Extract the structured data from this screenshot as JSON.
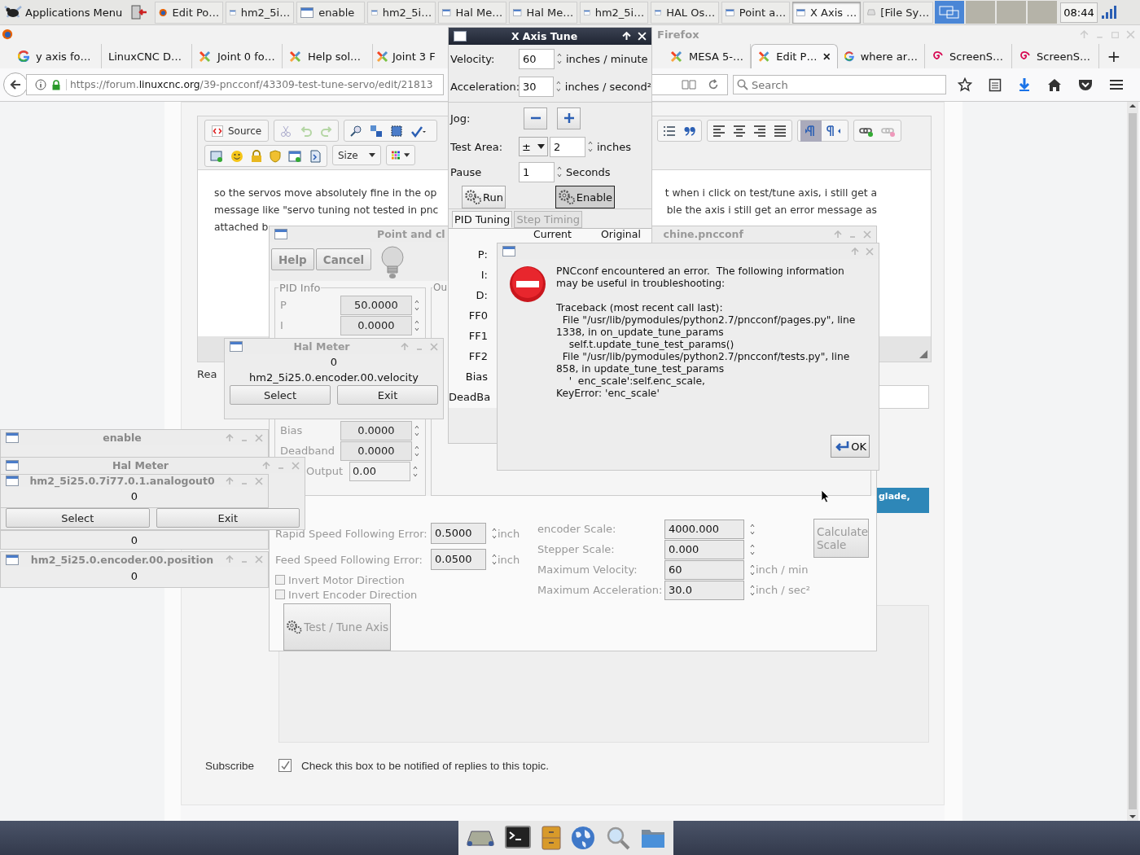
{
  "top_panel": {
    "apps_menu": "Applications Menu",
    "tasks": [
      {
        "label": "Edit Po…",
        "kind": "firefox",
        "selected": false
      },
      {
        "label": "hm2_5i…",
        "kind": "window",
        "selected": false
      },
      {
        "label": "enable",
        "kind": "window",
        "selected": false
      },
      {
        "label": "hm2_5i…",
        "kind": "window",
        "selected": false
      },
      {
        "label": "Hal Me…",
        "kind": "window",
        "selected": false
      },
      {
        "label": "Hal Me…",
        "kind": "window",
        "selected": false
      },
      {
        "label": "hm2_5i…",
        "kind": "window",
        "selected": false
      },
      {
        "label": "HAL Os…",
        "kind": "window",
        "selected": false
      },
      {
        "label": "Point a…",
        "kind": "window",
        "selected": false
      },
      {
        "label": "X Axis …",
        "kind": "window",
        "selected": true
      },
      {
        "label": "[File Sy…",
        "kind": "drive",
        "selected": false
      }
    ],
    "workspaces": [
      {
        "selected": true
      },
      {
        "selected": false
      },
      {
        "selected": false
      },
      {
        "selected": false
      }
    ],
    "clock": "08:44"
  },
  "firefox": {
    "title": "Firefox",
    "tabs": [
      {
        "label": "y axis fo…",
        "kind": "google",
        "selected": false
      },
      {
        "label": "LinuxCNC D…",
        "kind": "plain",
        "selected": false
      },
      {
        "label": "Joint 0 fo…",
        "kind": "joomla",
        "selected": false
      },
      {
        "label": "Help sol…",
        "kind": "joomla",
        "selected": false
      },
      {
        "label": "Joint 3 F",
        "kind": "joomla",
        "selected": false
      },
      {
        "label": "MESA 5-…",
        "kind": "joomla",
        "selected": false
      },
      {
        "label": "Edit P…",
        "kind": "joomla",
        "selected": true
      },
      {
        "label": "where ar…",
        "kind": "google",
        "selected": false
      },
      {
        "label": "ScreenS…",
        "kind": "debian",
        "selected": false
      },
      {
        "label": "ScreenS…",
        "kind": "debian",
        "selected": false
      }
    ],
    "new_tab": "+",
    "url": {
      "prefix": "https://forum.",
      "domain": "linuxcnc.org",
      "path": "/39-pncconf/43309-test-tune-servo/edit/21813"
    },
    "search_placeholder": "Search"
  },
  "editor": {
    "source_button": "Source",
    "size_menu": "Size",
    "lines": [
      {
        "left": "so the servos move absolutely fine in the op",
        "right": "t when i click on test/tune axis, i still get a"
      },
      {
        "left": "message like \"servo tuning not tested in pnc",
        "right": "ble the axis i still get an error message as"
      },
      {
        "left": "attached b"
      }
    ]
  },
  "page": {
    "reply_label": "Rea",
    "glade_button": "glade,",
    "subscribe_label": "Subscribe",
    "subscribe_checked": true,
    "subscribe_text": "Check this box to be notified of replies to this topic."
  },
  "pncconf": {
    "title_left": "Point and cl",
    "title_right": "chine.pncconf",
    "help": "Help",
    "cancel": "Cancel",
    "pid_frame": "PID Info",
    "output_frame": "Ou",
    "pid_rows": [
      {
        "label": "P",
        "value": "50.0000",
        "kind": "spin"
      },
      {
        "label": "I",
        "value": "0.0000",
        "kind": "spin"
      },
      {
        "label": "Bias",
        "value": "0.0000",
        "kind": "spin"
      },
      {
        "label": "Deadband",
        "value": "0.0000",
        "kind": "spin"
      },
      {
        "label": "Output",
        "value": "0.00",
        "kind": "entry"
      }
    ],
    "errors": [
      {
        "label": "Rapid Speed Following Error:",
        "value": "0.5000",
        "unit": "inch"
      },
      {
        "label": "Feed Speed Following Error:",
        "value": "0.0500",
        "unit": "inch"
      }
    ],
    "checks": [
      {
        "label": "Invert Motor Direction",
        "checked": false
      },
      {
        "label": "Invert Encoder Direction",
        "checked": false
      }
    ],
    "test_button": "Test / Tune Axis",
    "scales": [
      {
        "label": "encoder Scale:",
        "value": "4000.000"
      },
      {
        "label": "Stepper Scale:",
        "value": "0.000"
      },
      {
        "label": "Maximum Velocity:",
        "value": "60",
        "unit": "inch / min"
      },
      {
        "label": "Maximum Acceleration:",
        "value": "30.0",
        "unit": "inch / sec²"
      }
    ],
    "calculate_button": "Calculate Scale"
  },
  "x_axis_tune": {
    "title": "X Axis Tune",
    "fields": [
      {
        "label": "Velocity:",
        "value": "60",
        "unit": "inches / minute"
      },
      {
        "label": "Acceleration:",
        "value": "30",
        "unit": "inches / second²"
      }
    ],
    "jog_label": "Jog:",
    "test_area": {
      "label": "Test Area:",
      "sign": "±",
      "value": "2",
      "unit": "inches"
    },
    "pause": {
      "label": "Pause",
      "value": "1",
      "unit": "Seconds"
    },
    "run": {
      "label": "Run",
      "on": false
    },
    "enable": {
      "label": "Enable",
      "on": true
    },
    "tabs": [
      {
        "label": "PID Tuning",
        "selected": true
      },
      {
        "label": "Step Timing",
        "selected": false
      }
    ],
    "columns": [
      "Current",
      "Original"
    ],
    "params": [
      "P:",
      "I:",
      "D:",
      "FF0",
      "FF1",
      "FF2",
      "Bias",
      "DeadBa"
    ]
  },
  "error_dialog": {
    "message": "PNCconf encountered an error.  The following information\nmay be useful in troubleshooting:\n\nTraceback (most recent call last):\n  File \"/usr/lib/pymodules/python2.7/pncconf/pages.py\", line\n1338, in on_update_tune_params\n    self.t.update_tune_test_params()\n  File \"/usr/lib/pymodules/python2.7/pncconf/tests.py\", line\n858, in update_tune_test_params\n    '  enc_scale':self.enc_scale,\nKeyError: 'enc_scale'",
    "ok": "OK"
  },
  "hal_meter": {
    "title": "Hal Meter",
    "value": "0",
    "pin": "hm2_5i25.0.encoder.00.velocity",
    "select": "Select",
    "exit": "Exit"
  },
  "left_windows": [
    {
      "title": "enable"
    },
    {
      "title": "Hal Meter",
      "select": "Select",
      "exit": "Exit"
    },
    {
      "title": "hm2_5i25.0.7i77.0.1.analogout0",
      "value": "0"
    },
    {
      "value": "0"
    },
    {
      "title": "hm2_5i25.0.encoder.00.position",
      "value": "0"
    }
  ]
}
